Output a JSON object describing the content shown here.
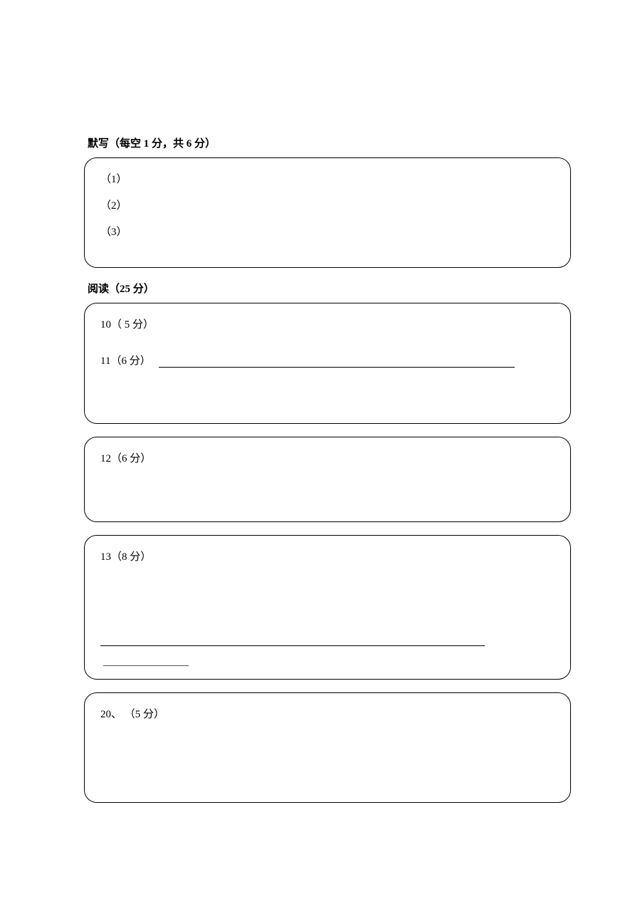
{
  "section1": {
    "title": "默写（每空 1 分，共 6 分）",
    "items": [
      "（1）",
      "（2）",
      "（3）"
    ]
  },
  "section2": {
    "title": "阅读（25 分）"
  },
  "box2": {
    "line1": "10（ 5 分）",
    "line2": "11（6 分）"
  },
  "box3": {
    "line1": "12（6 分）"
  },
  "box4": {
    "line1": "13（8 分）"
  },
  "box5": {
    "line1": "20、 （5 分）"
  }
}
